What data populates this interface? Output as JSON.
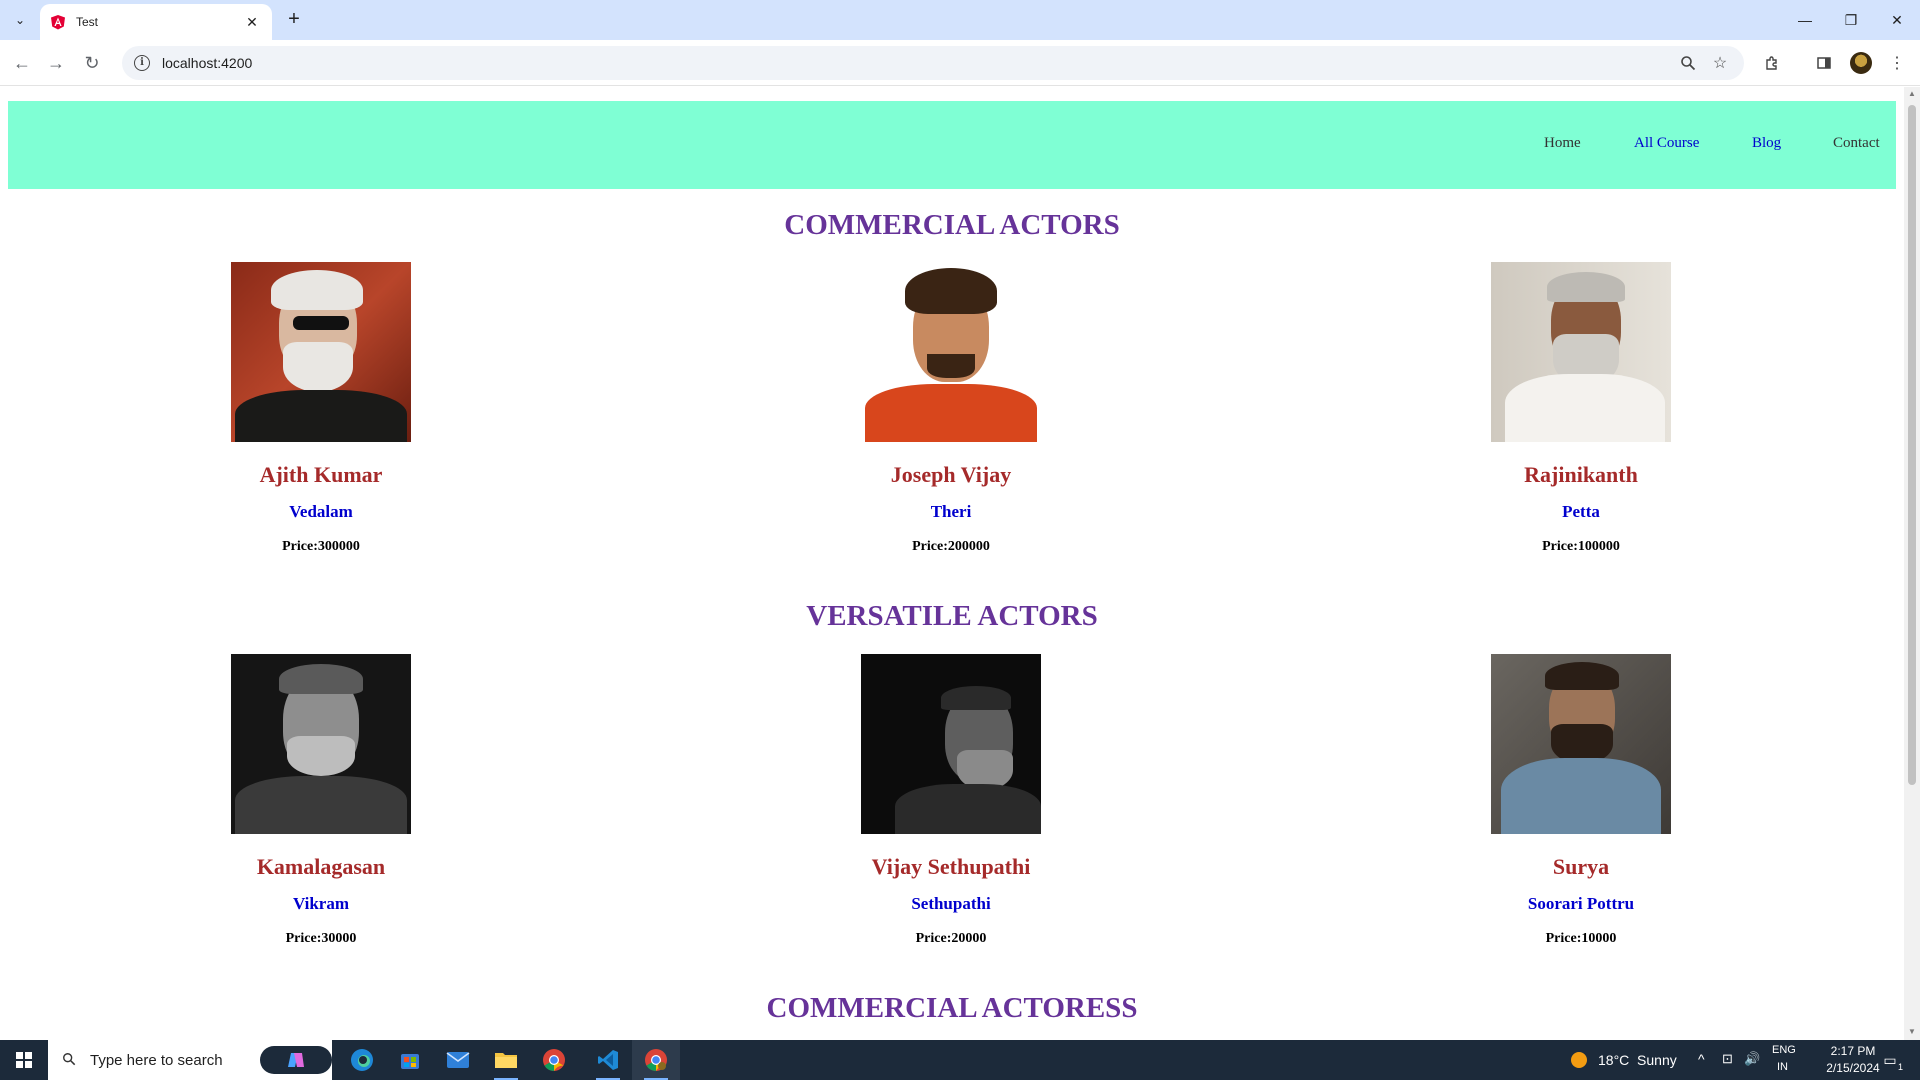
{
  "browser": {
    "tab_title": "Test",
    "url": "localhost:4200"
  },
  "site": {
    "nav": [
      "Home",
      "All Course",
      "Blog",
      "Contact"
    ],
    "nav_colors": [
      "#333333",
      "#0000cd",
      "#0000cd",
      "#333333"
    ]
  },
  "sections": [
    {
      "title": "COMMERCIAL ACTORS",
      "cards": [
        {
          "name": "Ajith Kumar",
          "movie": "Vedalam",
          "price": "Price:300000"
        },
        {
          "name": "Joseph Vijay",
          "movie": "Theri",
          "price": "Price:200000"
        },
        {
          "name": "Rajinikanth",
          "movie": "Petta",
          "price": "Price:100000"
        }
      ]
    },
    {
      "title": "VERSATILE ACTORS",
      "cards": [
        {
          "name": "Kamalagasan",
          "movie": "Vikram",
          "price": "Price:30000"
        },
        {
          "name": "Vijay Sethupathi",
          "movie": "Sethupathi",
          "price": "Price:20000"
        },
        {
          "name": "Surya",
          "movie": "Soorari Pottru",
          "price": "Price:10000"
        }
      ]
    },
    {
      "title": "COMMERCIAL ACTORESS",
      "cards": []
    }
  ],
  "taskbar": {
    "search_placeholder": "Type here to search",
    "weather": "18°C  Sunny",
    "lang_1": "ENG",
    "lang_2": "IN",
    "time": "2:17 PM",
    "date": "2/15/2024",
    "notification_count": "1"
  },
  "colors": {
    "nav_bg": "#7fffd4",
    "section_title": "#663399",
    "actor_name": "#a52a2a",
    "movie": "#0000cd"
  }
}
